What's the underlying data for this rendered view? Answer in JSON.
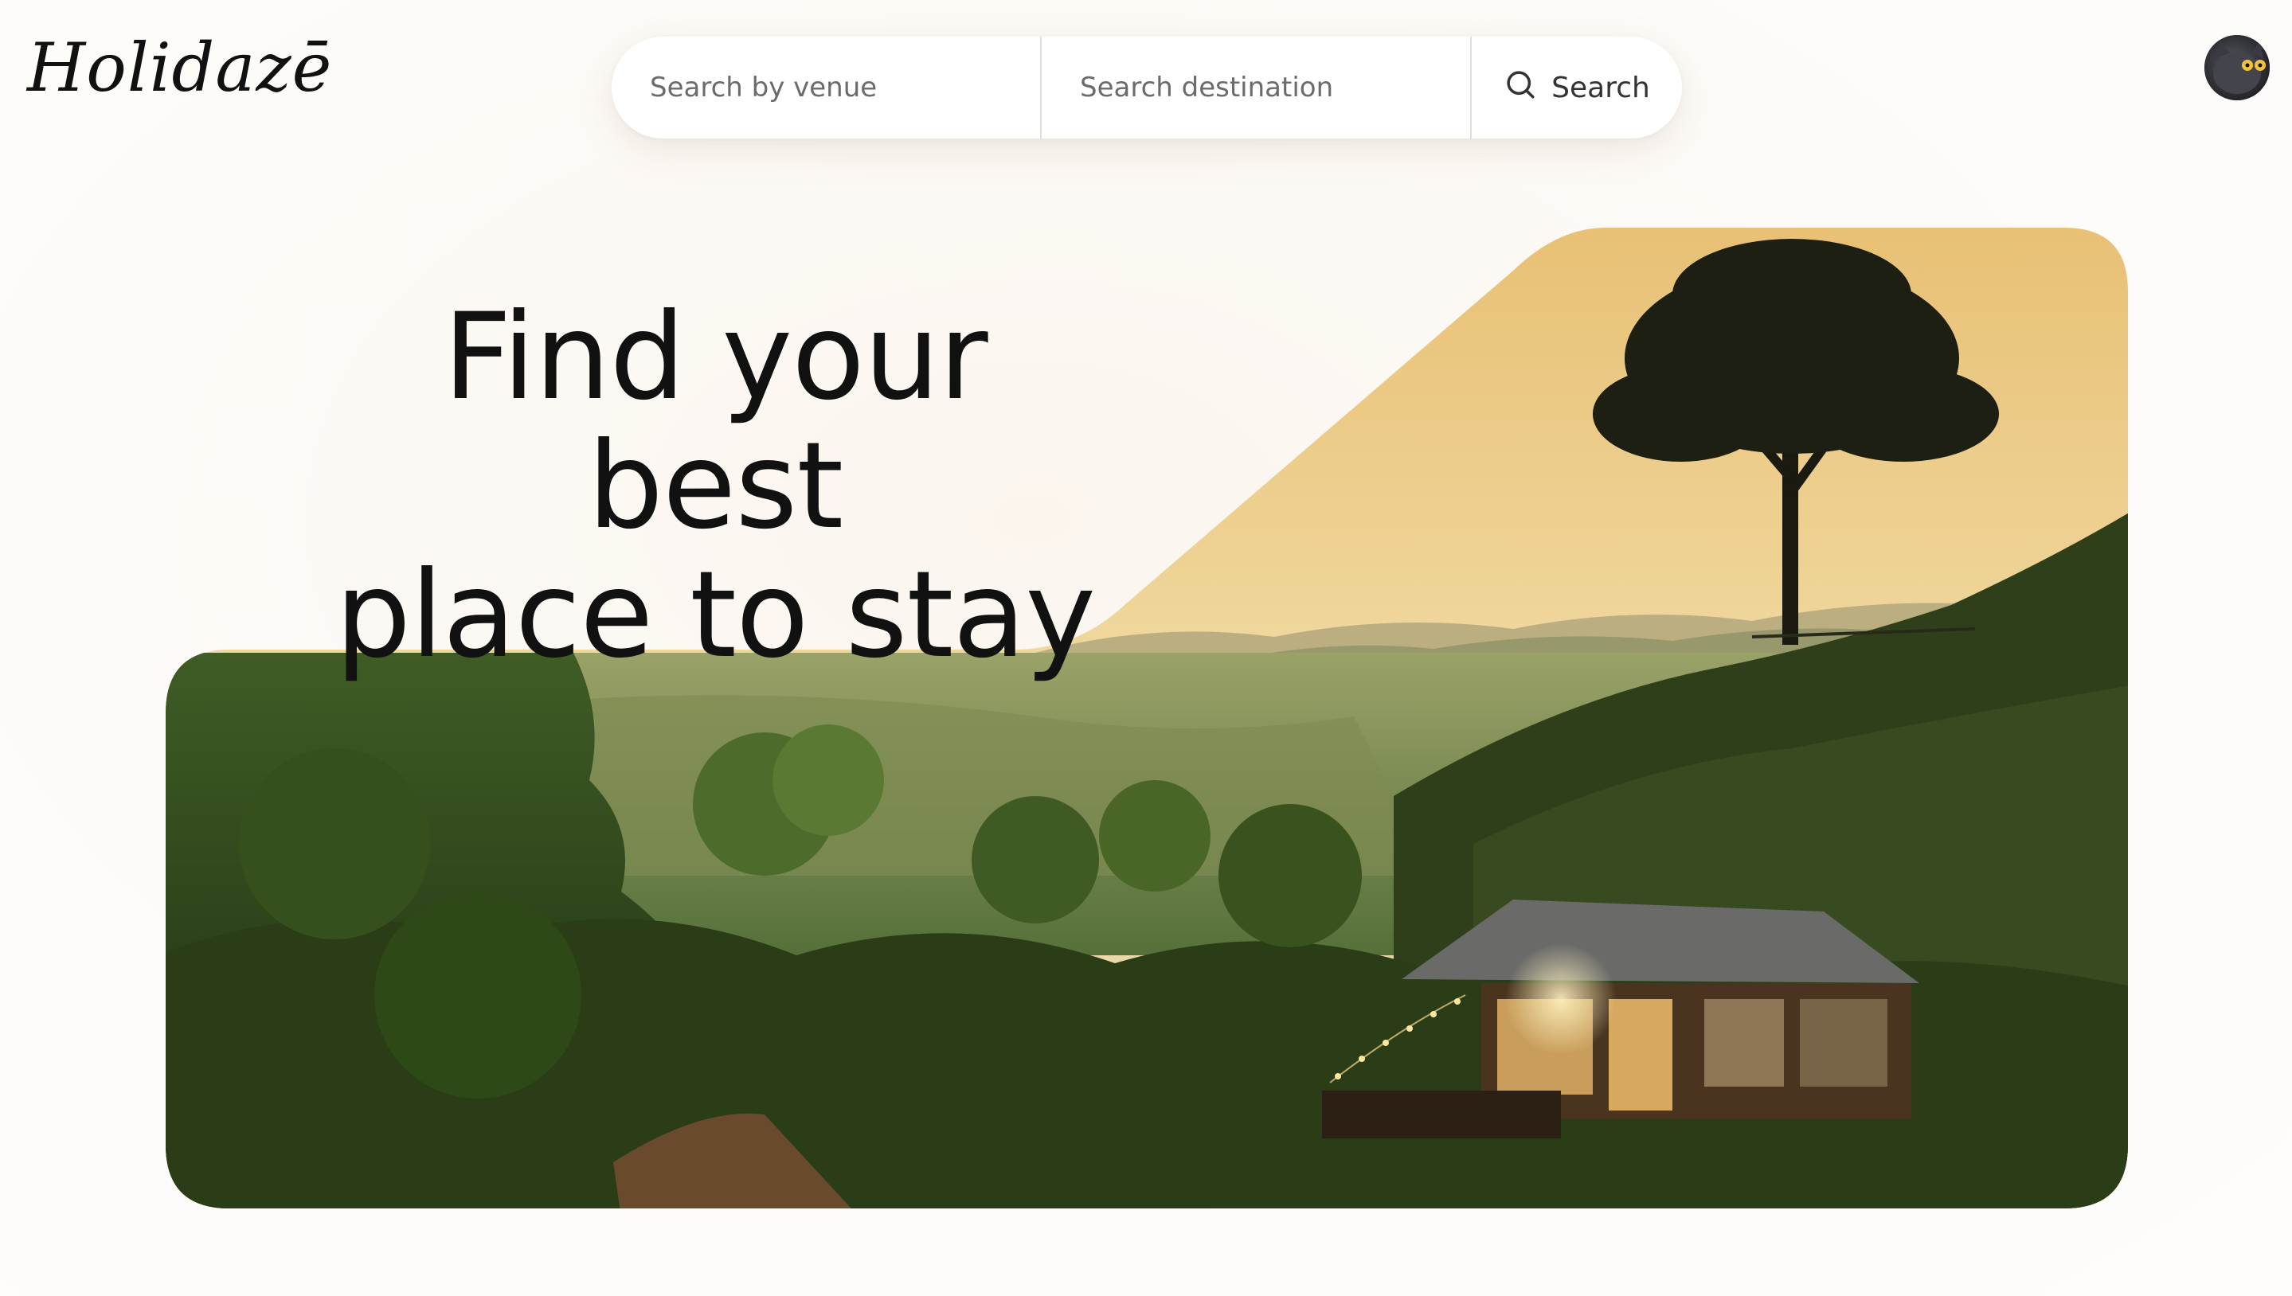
{
  "header": {
    "logo_text": "Holidazē",
    "search": {
      "venue_placeholder": "Search by venue",
      "destination_placeholder": "Search destination",
      "button_label": "Search"
    }
  },
  "hero": {
    "heading_line1": "Find your best",
    "heading_line2": "place to stay"
  },
  "colors": {
    "page_background": "#fdfbf8",
    "sky": "#e9c983",
    "foliage": "#3e5a24",
    "text": "#111111"
  },
  "icons": {
    "search": "search-icon",
    "avatar": "user-avatar"
  }
}
